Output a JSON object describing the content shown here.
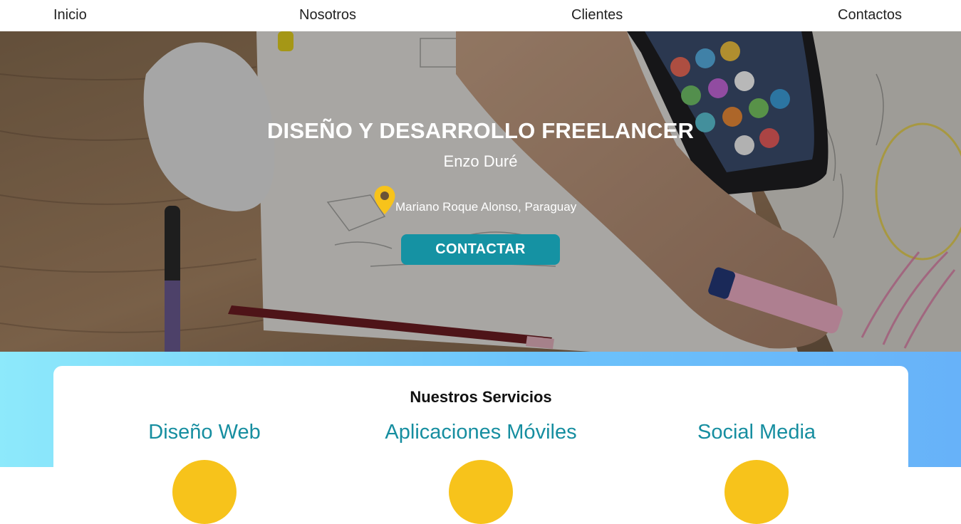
{
  "nav": {
    "items": [
      {
        "label": "Inicio"
      },
      {
        "label": "Nosotros"
      },
      {
        "label": "Clientes"
      },
      {
        "label": "Contactos"
      }
    ]
  },
  "hero": {
    "title": "DISEÑO Y DESARROLLO FREELANCER",
    "name": "Enzo Duré",
    "location": "Mariano Roque Alonso, Paraguay",
    "cta_label": "CONTACTAR",
    "icon": "location-pin-icon"
  },
  "services": {
    "title": "Nuestros Servicios",
    "items": [
      {
        "title": "Diseño Web",
        "icon": "web-design-icon"
      },
      {
        "title": "Aplicaciones Móviles",
        "icon": "mobile-apps-icon"
      },
      {
        "title": "Social Media",
        "icon": "social-media-icon"
      }
    ]
  },
  "colors": {
    "accent": "#1592a3",
    "service_title": "#168ea0",
    "pin": "#f7c31b",
    "gradient_start": "#8de9fb",
    "gradient_end": "#67b2f9"
  }
}
